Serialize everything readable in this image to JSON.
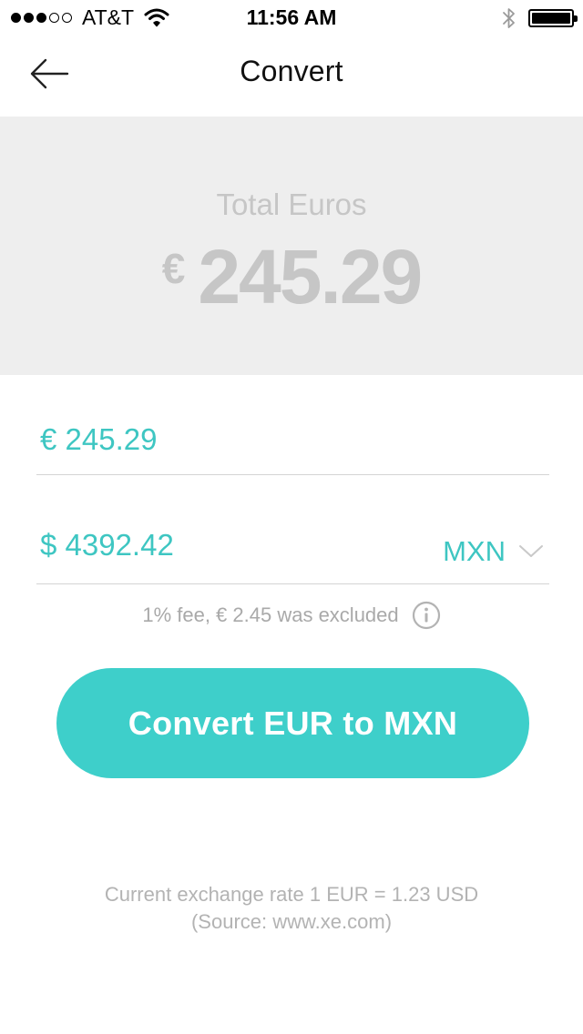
{
  "status_bar": {
    "carrier": "AT&T",
    "time": "11:56 AM",
    "signal_bars_filled": 3,
    "signal_bars_total": 5
  },
  "nav": {
    "title": "Convert",
    "back_icon": "arrow-left-icon"
  },
  "total": {
    "label": "Total Euros",
    "symbol": "€",
    "value": "245.29"
  },
  "euro_field": {
    "value": "€ 245.29"
  },
  "peso_field": {
    "value": "$ 4392.42",
    "currency": "MXN",
    "dropdown_icon": "chevron-down-icon"
  },
  "fee": {
    "text": "1% fee, € 2.45 was excluded",
    "icon": "info-icon"
  },
  "convert_button": {
    "label": "Convert EUR to MXN"
  },
  "footer": {
    "rate_text": "Current exchange rate 1 EUR = 1.23 USD",
    "source_text": "(Source: www.xe.com)"
  },
  "colors": {
    "accent": "#3ecfca",
    "accent_text": "#3ec6c2",
    "panel_bg": "#eeeeee",
    "muted_text": "#c6c6c6"
  }
}
